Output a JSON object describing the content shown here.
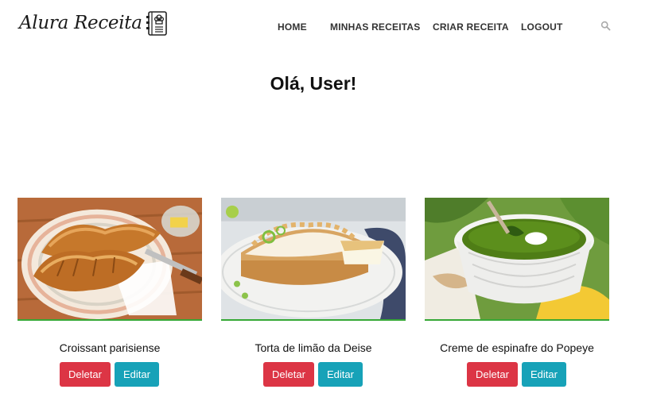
{
  "brand": {
    "name": "Alura Receita"
  },
  "nav": {
    "items": [
      "HOME",
      "MINHAS RECEITAS",
      "CRIAR RECEITA",
      "LOGOUT"
    ],
    "search_icon": "search-icon"
  },
  "greeting": "Olá, User!",
  "recipes": [
    {
      "title": "Croissant parisiense",
      "delete_label": "Deletar",
      "edit_label": "Editar"
    },
    {
      "title": "Torta de limão da Deise",
      "delete_label": "Deletar",
      "edit_label": "Editar"
    },
    {
      "title": "Creme de espinafre do Popeye",
      "delete_label": "Deletar",
      "edit_label": "Editar"
    }
  ],
  "colors": {
    "delete": "#dc3545",
    "edit": "#17a2b8",
    "accent": "#36a836"
  }
}
